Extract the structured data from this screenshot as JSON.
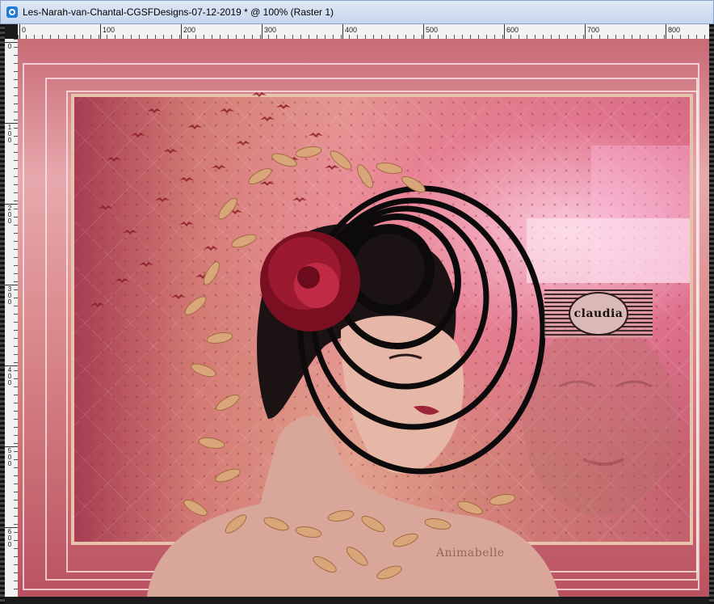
{
  "window": {
    "title": "Les-Narah-van-Chantal-CGSFDesigns-07-12-2019 * @ 100% (Raster 1)"
  },
  "ruler": {
    "horizontal_labels": [
      "0",
      "100",
      "200",
      "300",
      "400",
      "500",
      "600",
      "700",
      "800"
    ],
    "vertical_labels": [
      "0",
      "100",
      "200",
      "300",
      "400",
      "500",
      "600"
    ]
  },
  "artwork": {
    "logo_text": "claudia",
    "watermark_text": "Animabelle"
  },
  "colors": {
    "background": "#c86a76",
    "frame": "#e8c2aa",
    "accent_pink": "#e07aa0"
  },
  "icons": {
    "app": "paint-shop-pro-icon"
  }
}
